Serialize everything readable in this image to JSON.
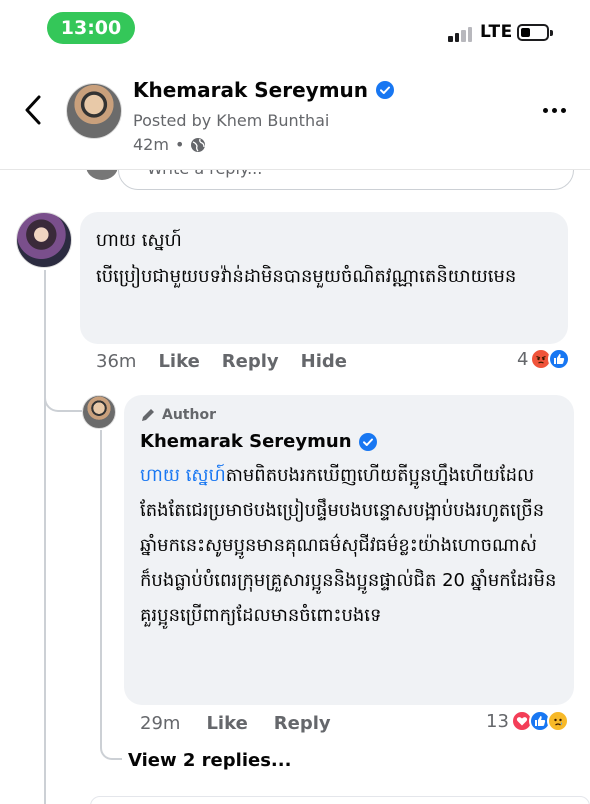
{
  "status_bar": {
    "time": "13:00",
    "network": "LTE",
    "colors": {
      "time_pill": "#34c759"
    }
  },
  "header": {
    "author_name": "Khemarak Sereymun",
    "posted_by": "Posted by Khem Bunthai",
    "timestamp": "42m",
    "timestamp_sep": "•",
    "verified": true,
    "icons": [
      "back-icon",
      "verified-icon",
      "globe-icon",
      "more-icon"
    ]
  },
  "reply_box_top": {
    "placeholder": "Write a reply..."
  },
  "comment_1": {
    "author": "ហាយ ស្នេហ៍",
    "text": "បើប្រៀបជាមួយបទវ៉ាន់ដាមិនបានមួយចំណិតវណ្ណាតេនិយាយមេន",
    "time": "36m",
    "actions": {
      "like": "Like",
      "reply": "Reply",
      "hide": "Hide"
    },
    "reaction_count": "4",
    "reactions": [
      "angry",
      "like"
    ]
  },
  "reply_1": {
    "badge": "Author",
    "author": "Khemarak Sereymun",
    "verified": true,
    "mention": "ហាយ ស្នេហ៍",
    "text": "តាមពិតបងរកឃើញហើយតីប្អូនហ្នឹងហើយដែលតែងតែជេរប្រមាថបងប្រៀបផ្ទឹមបងបន្ទោសបង្អាប់បងរហូតច្រើនឆ្នាំមកនេះសូមប្អូនមានគុណធម៌សុជីវធម៌ខ្លះយ៉ាងហោចណាស់ក៏បងធ្លាប់បំពេរក្រុមគ្រួសារប្អូននិងប្អូនផ្ទាល់ជិត 20 ឆ្នាំមកដែរមិនគួរប្អូនប្រើពាក្យដែលមានចំពោះបងទេ",
    "time": "29m",
    "actions": {
      "like": "Like",
      "reply": "Reply"
    },
    "reaction_count": "13",
    "reactions": [
      "love",
      "like",
      "sad"
    ]
  },
  "view_replies": "View 2 replies..."
}
